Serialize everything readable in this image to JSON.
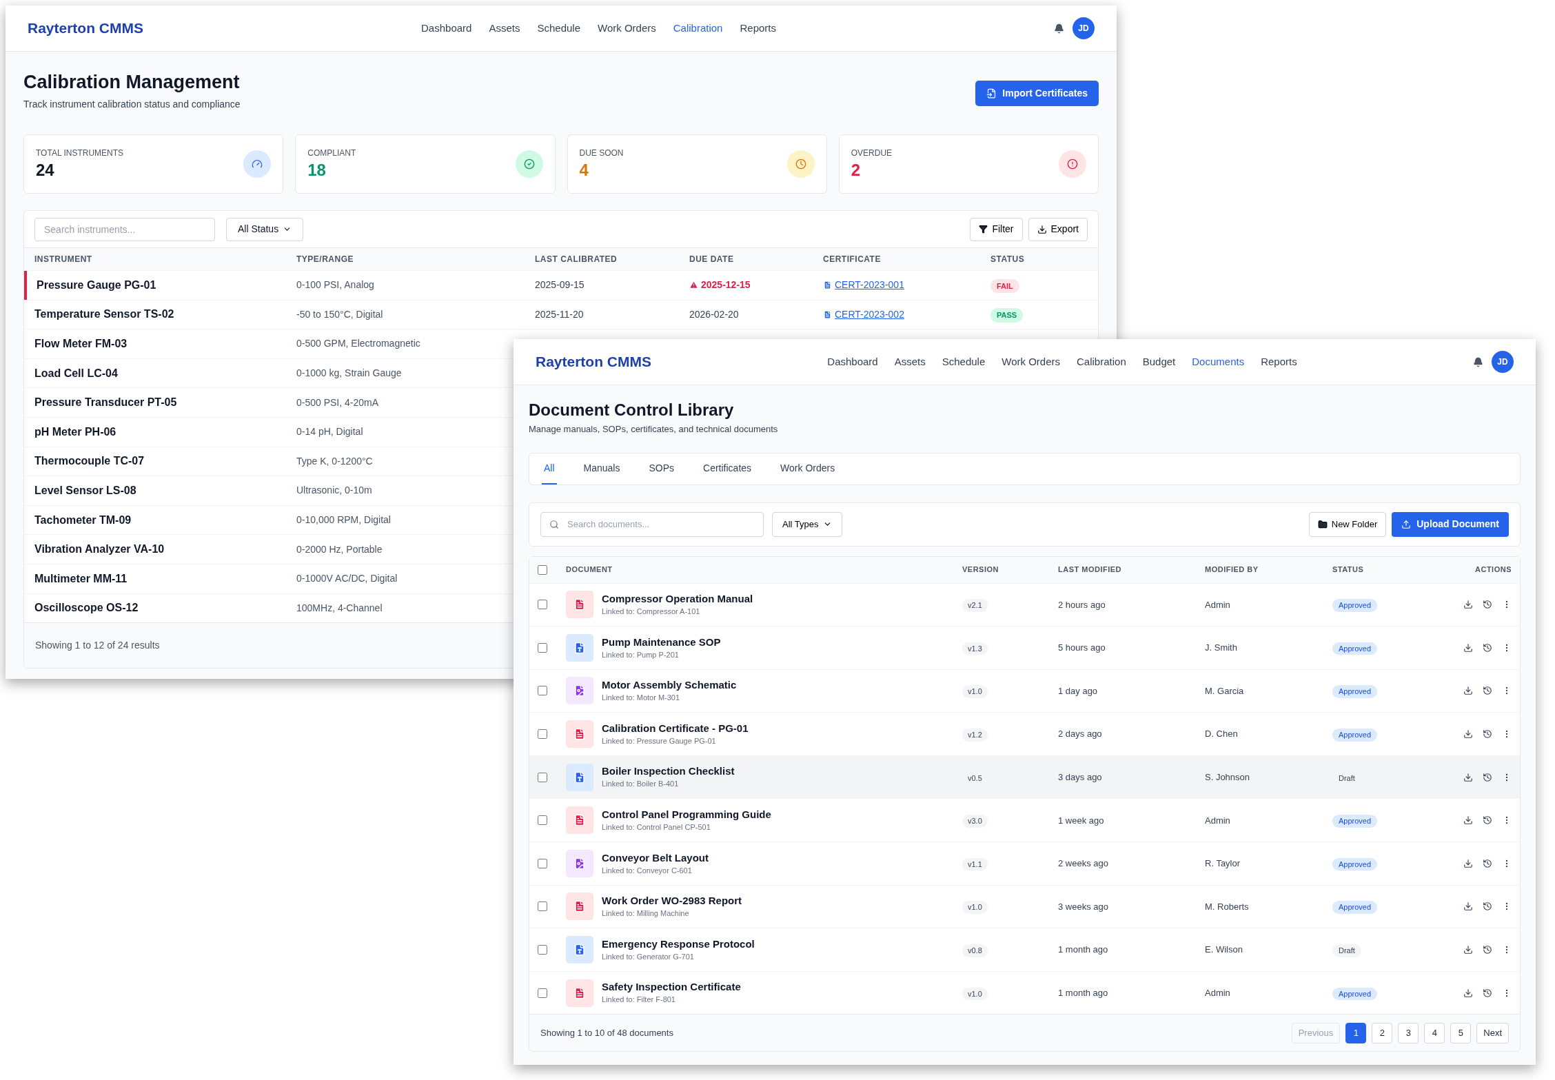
{
  "calibration_window": {
    "brand": "Rayterton CMMS",
    "nav": [
      {
        "label": "Dashboard",
        "selected": false
      },
      {
        "label": "Assets",
        "selected": false
      },
      {
        "label": "Schedule",
        "selected": false
      },
      {
        "label": "Work Orders",
        "selected": false
      },
      {
        "label": "Calibration",
        "selected": true
      },
      {
        "label": "Reports",
        "selected": false
      }
    ],
    "avatar": "JD",
    "title": "Calibration Management",
    "subtitle": "Track instrument calibration status and compliance",
    "import_button": "Import Certificates",
    "stats": [
      {
        "kind": "total",
        "label": "TOTAL INSTRUMENTS",
        "value": "24",
        "color": "#111827"
      },
      {
        "kind": "compliant",
        "label": "COMPLIANT",
        "value": "18",
        "color": "#059669"
      },
      {
        "kind": "due_soon",
        "label": "DUE SOON",
        "value": "4",
        "color": "#d97706"
      },
      {
        "kind": "overdue",
        "label": "OVERDUE",
        "value": "2",
        "color": "#e11d48"
      }
    ],
    "search": {
      "placeholder": "Search instruments..."
    },
    "status_filter": "All Status",
    "filter_button": "Filter",
    "export_button": "Export",
    "columns": [
      "INSTRUMENT",
      "TYPE/RANGE",
      "LAST CALIBRATED",
      "DUE DATE",
      "CERTIFICATE",
      "STATUS"
    ],
    "rows": [
      {
        "instrument": "Pressure Gauge PG-01",
        "type_range": "0-100 PSI, Analog",
        "last_calibrated": "2025-09-15",
        "due_date": "2025-12-15",
        "overdue": true,
        "certificate": "CERT-2023-001",
        "status": {
          "kind": "fail",
          "label": "FAIL"
        },
        "flagged": true
      },
      {
        "instrument": "Temperature Sensor TS-02",
        "type_range": "-50 to 150°C, Digital",
        "last_calibrated": "2025-11-20",
        "due_date": "2026-02-20",
        "overdue": false,
        "certificate": "CERT-2023-002",
        "status": {
          "kind": "pass",
          "label": "PASS"
        },
        "flagged": false
      },
      {
        "instrument": "Flow Meter FM-03",
        "type_range": "0-500 GPM, Electromagnetic",
        "flagged": false
      },
      {
        "instrument": "Load Cell LC-04",
        "type_range": "0-1000 kg, Strain Gauge",
        "flagged": false
      },
      {
        "instrument": "Pressure Transducer PT-05",
        "type_range": "0-500 PSI, 4-20mA",
        "flagged": false
      },
      {
        "instrument": "pH Meter PH-06",
        "type_range": "0-14 pH, Digital",
        "flagged": false
      },
      {
        "instrument": "Thermocouple TC-07",
        "type_range": "Type K, 0-1200°C",
        "flagged": false
      },
      {
        "instrument": "Level Sensor LS-08",
        "type_range": "Ultrasonic, 0-10m",
        "flagged": false
      },
      {
        "instrument": "Tachometer TM-09",
        "type_range": "0-10,000 RPM, Digital",
        "flagged": false
      },
      {
        "instrument": "Vibration Analyzer VA-10",
        "type_range": "0-2000 Hz, Portable",
        "flagged": false
      },
      {
        "instrument": "Multimeter MM-11",
        "type_range": "0-1000V AC/DC, Digital",
        "flagged": false
      },
      {
        "instrument": "Oscilloscope OS-12",
        "type_range": "100MHz, 4-Channel",
        "flagged": false
      }
    ],
    "footer": "Showing 1 to 12 of 24 results"
  },
  "documents_window": {
    "brand": "Rayterton CMMS",
    "nav": [
      {
        "label": "Dashboard",
        "selected": false
      },
      {
        "label": "Assets",
        "selected": false
      },
      {
        "label": "Schedule",
        "selected": false
      },
      {
        "label": "Work Orders",
        "selected": false
      },
      {
        "label": "Calibration",
        "selected": false
      },
      {
        "label": "Budget",
        "selected": false
      },
      {
        "label": "Documents",
        "selected": true
      },
      {
        "label": "Reports",
        "selected": false
      }
    ],
    "avatar": "JD",
    "title": "Document Control Library",
    "subtitle": "Manage manuals, SOPs, certificates, and technical documents",
    "tabs": [
      {
        "label": "All",
        "selected": true
      },
      {
        "label": "Manuals",
        "selected": false
      },
      {
        "label": "SOPs",
        "selected": false
      },
      {
        "label": "Certificates",
        "selected": false
      },
      {
        "label": "Work Orders",
        "selected": false
      }
    ],
    "search": {
      "placeholder": "Search documents..."
    },
    "type_filter": "All Types",
    "new_folder_button": "New Folder",
    "upload_button": "Upload Document",
    "select_all": {
      "checked": false
    },
    "columns": [
      "DOCUMENT",
      "VERSION",
      "LAST MODIFIED",
      "MODIFIED BY",
      "STATUS",
      "ACTIONS"
    ],
    "rows": [
      {
        "kind": "pdf",
        "name": "Compressor Operation Manual",
        "linked": "Linked to: Compressor A-101",
        "version": "v2.1",
        "modified": "2 hours ago",
        "by": "Admin",
        "status": {
          "kind": "approved",
          "label": "Approved"
        },
        "checked": false,
        "hovered": false
      },
      {
        "kind": "word",
        "name": "Pump Maintenance SOP",
        "linked": "Linked to: Pump P-201",
        "version": "v1.3",
        "modified": "5 hours ago",
        "by": "J. Smith",
        "status": {
          "kind": "approved",
          "label": "Approved"
        },
        "checked": false,
        "hovered": false
      },
      {
        "kind": "image",
        "name": "Motor Assembly Schematic",
        "linked": "Linked to: Motor M-301",
        "version": "v1.0",
        "modified": "1 day ago",
        "by": "M. Garcia",
        "status": {
          "kind": "approved",
          "label": "Approved"
        },
        "checked": false,
        "hovered": false
      },
      {
        "kind": "pdf",
        "name": "Calibration Certificate - PG-01",
        "linked": "Linked to: Pressure Gauge PG-01",
        "version": "v1.2",
        "modified": "2 days ago",
        "by": "D. Chen",
        "status": {
          "kind": "approved",
          "label": "Approved"
        },
        "checked": false,
        "hovered": false
      },
      {
        "kind": "word",
        "name": "Boiler Inspection Checklist",
        "linked": "Linked to: Boiler B-401",
        "version": "v0.5",
        "modified": "3 days ago",
        "by": "S. Johnson",
        "status": {
          "kind": "draft",
          "label": "Draft"
        },
        "checked": false,
        "hovered": true
      },
      {
        "kind": "pdf",
        "name": "Control Panel Programming Guide",
        "linked": "Linked to: Control Panel CP-501",
        "version": "v3.0",
        "modified": "1 week ago",
        "by": "Admin",
        "status": {
          "kind": "approved",
          "label": "Approved"
        },
        "checked": false,
        "hovered": false
      },
      {
        "kind": "image",
        "name": "Conveyor Belt Layout",
        "linked": "Linked to: Conveyor C-601",
        "version": "v1.1",
        "modified": "2 weeks ago",
        "by": "R. Taylor",
        "status": {
          "kind": "approved",
          "label": "Approved"
        },
        "checked": false,
        "hovered": false
      },
      {
        "kind": "pdf",
        "name": "Work Order WO-2983 Report",
        "linked": "Linked to: Milling Machine",
        "version": "v1.0",
        "modified": "3 weeks ago",
        "by": "M. Roberts",
        "status": {
          "kind": "approved",
          "label": "Approved"
        },
        "checked": false,
        "hovered": false
      },
      {
        "kind": "word",
        "name": "Emergency Response Protocol",
        "linked": "Linked to: Generator G-701",
        "version": "v0.8",
        "modified": "1 month ago",
        "by": "E. Wilson",
        "status": {
          "kind": "draft",
          "label": "Draft"
        },
        "checked": false,
        "hovered": false
      },
      {
        "kind": "pdf",
        "name": "Safety Inspection Certificate",
        "linked": "Linked to: Filter F-801",
        "version": "v1.0",
        "modified": "1 month ago",
        "by": "Admin",
        "status": {
          "kind": "approved",
          "label": "Approved"
        },
        "checked": false,
        "hovered": false
      }
    ],
    "footer": "Showing 1 to 10 of 48 documents",
    "pagination": {
      "previous": {
        "label": "Previous",
        "disabled": true
      },
      "pages": [
        {
          "label": "1",
          "selected": true
        },
        {
          "label": "2",
          "selected": false
        },
        {
          "label": "3",
          "selected": false
        },
        {
          "label": "4",
          "selected": false
        },
        {
          "label": "5",
          "selected": false
        }
      ],
      "next": {
        "label": "Next",
        "disabled": false
      }
    }
  }
}
